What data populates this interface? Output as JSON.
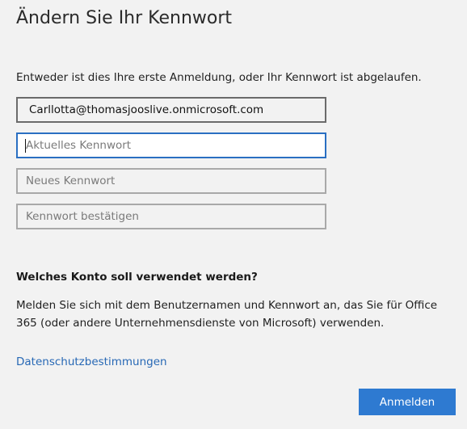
{
  "header": {
    "title": "Ändern Sie Ihr Kennwort"
  },
  "intro_text": "Entweder ist dies Ihre erste Anmeldung, oder Ihr Kennwort ist abgelaufen.",
  "form": {
    "account": {
      "value": "Carllotta@thomasjooslive.onmicrosoft.com"
    },
    "current_password": {
      "placeholder": "Aktuelles Kennwort"
    },
    "new_password": {
      "placeholder": "Neues Kennwort"
    },
    "confirm_password": {
      "placeholder": "Kennwort bestätigen"
    }
  },
  "help": {
    "heading": "Welches Konto soll verwendet werden?",
    "body": "Melden Sie sich mit dem Benutzernamen und Kennwort an, das Sie für Office 365 (oder andere Unternehmensdienste von Microsoft) verwenden."
  },
  "links": {
    "privacy": "Datenschutzbestimmungen"
  },
  "actions": {
    "submit_label": "Anmelden"
  },
  "colors": {
    "accent": "#2e7ad1",
    "focus_border": "#2a6fc2",
    "link": "#2768b5",
    "background": "#f2f2f2"
  }
}
